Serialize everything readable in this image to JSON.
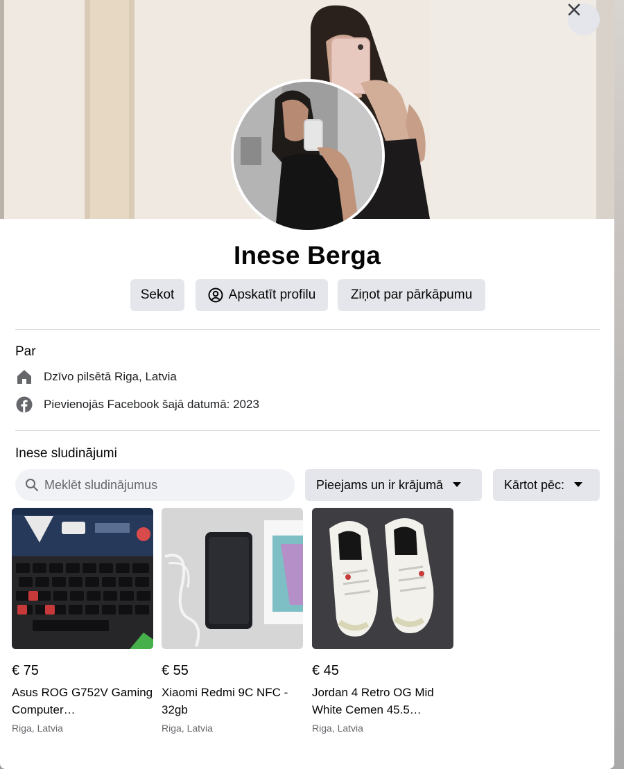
{
  "profile": {
    "name": "Inese Berga"
  },
  "actions": {
    "follow_label": "Sekot",
    "view_profile_label": "Apskatīt profilu",
    "report_label": "Ziņot par pārkāpumu"
  },
  "about": {
    "title": "Par",
    "lives_prefix": "Dzīvo pilsētā ",
    "lives_city": "Riga, Latvia",
    "joined": "Pievienojās Facebook šajā datumā: 2023"
  },
  "listings_section": {
    "title": "Inese sludinājumi",
    "search_placeholder": "Meklēt sludinājumus",
    "availability_filter": "Pieejams un ir krājumā",
    "sort_label": "Kārtot pēc:"
  },
  "listings": [
    {
      "price": "€ 75",
      "title": "Asus ROG G752V Gaming Computer…",
      "location": "Riga, Latvia"
    },
    {
      "price": "€ 55",
      "title": "Xiaomi Redmi 9C NFC - 32gb",
      "location": "Riga, Latvia"
    },
    {
      "price": "€ 45",
      "title": "Jordan 4 Retro OG Mid White Cemen 45.5…",
      "location": "Riga, Latvia"
    }
  ],
  "icons": {
    "close": "close-icon",
    "view_profile": "user-circle-icon",
    "home": "home-icon",
    "facebook": "facebook-icon",
    "search": "search-icon",
    "dropdown": "caret-down-icon"
  },
  "colors": {
    "button_bg": "#e4e6eb",
    "search_bg": "#f0f2f5",
    "secondary_text": "#65676b",
    "icon_gray": "#65676b"
  }
}
